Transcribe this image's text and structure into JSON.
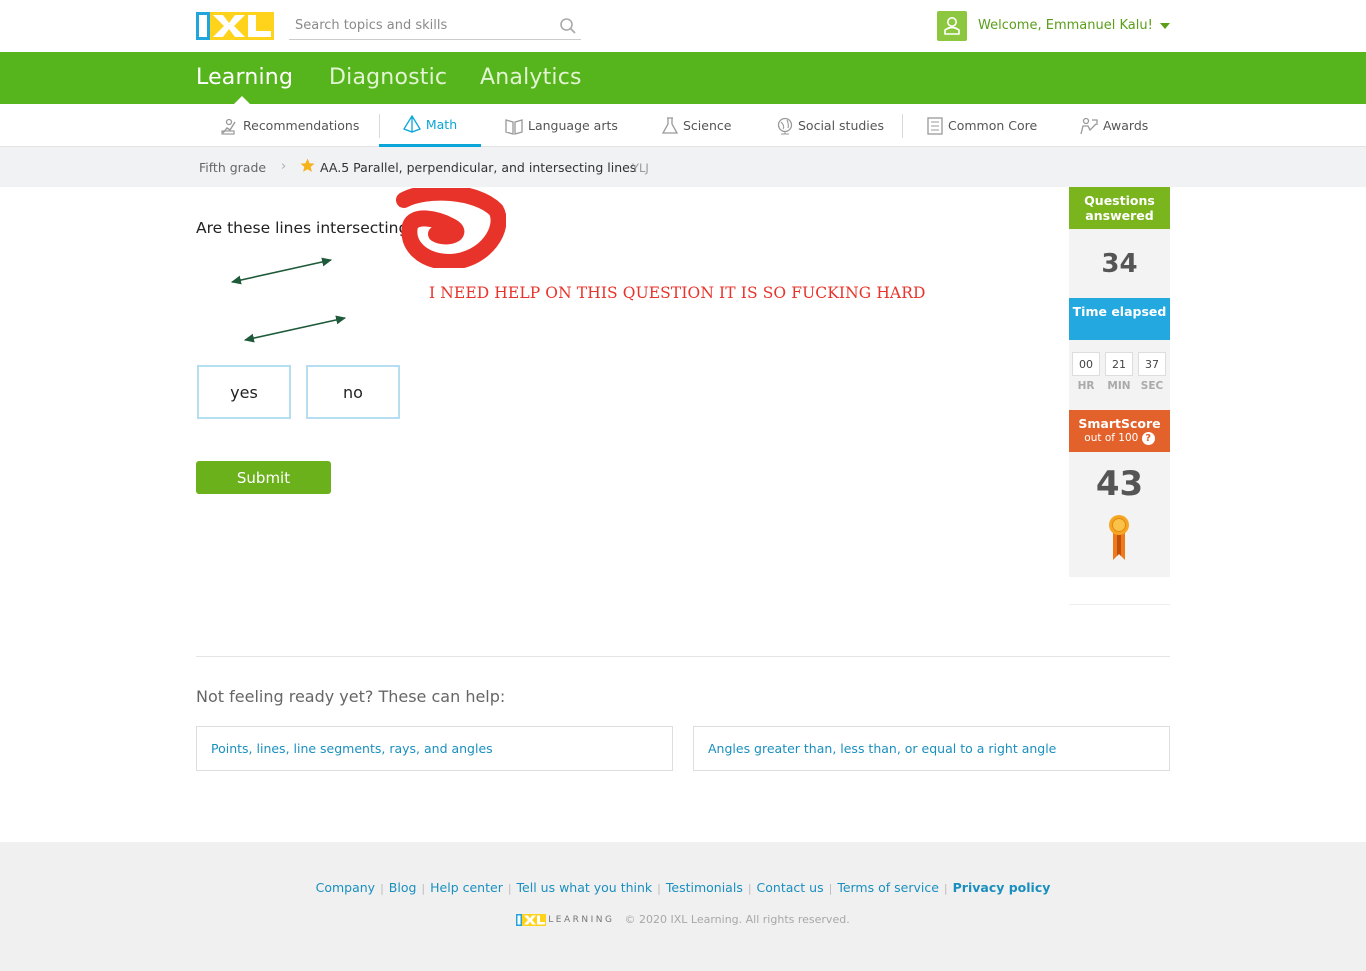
{
  "header": {
    "search_placeholder": "Search topics and skills",
    "welcome": "Welcome, Emmanuel Kalu!"
  },
  "main_nav": {
    "tabs": [
      {
        "label": "Learning",
        "active": true
      },
      {
        "label": "Diagnostic",
        "active": false
      },
      {
        "label": "Analytics",
        "active": false
      }
    ]
  },
  "subject_nav": {
    "items": [
      {
        "label": "Recommendations",
        "icon": "recommendations-icon"
      },
      {
        "label": "Math",
        "icon": "math-pyramid-icon",
        "active": true
      },
      {
        "label": "Language arts",
        "icon": "book-icon"
      },
      {
        "label": "Science",
        "icon": "flask-icon"
      },
      {
        "label": "Social studies",
        "icon": "globe-icon"
      },
      {
        "label": "Common Core",
        "icon": "list-icon"
      },
      {
        "label": "Awards",
        "icon": "awards-icon"
      }
    ]
  },
  "breadcrumb": {
    "grade": "Fifth grade",
    "skill": "AA.5 Parallel, perpendicular, and intersecting lines",
    "code": "YLJ"
  },
  "question": {
    "prompt": "Are these lines intersecting?",
    "annotation": "I NEED HELP ON THIS QUESTION IT IS SO FUCKING HARD",
    "choices": [
      "yes",
      "no"
    ],
    "submit_label": "Submit"
  },
  "stats": {
    "questions_answered_label": "Questions answered",
    "questions_answered": "34",
    "time_elapsed_label": "Time elapsed",
    "time": {
      "hr": "00",
      "min": "21",
      "sec": "37"
    },
    "time_units": {
      "hr": "HR",
      "min": "MIN",
      "sec": "SEC"
    },
    "smartscore_label": "SmartScore",
    "smartscore_sub": "out of 100",
    "smartscore_help": "?",
    "smartscore": "43"
  },
  "help_section": {
    "title": "Not feeling ready yet? These can help:",
    "cards": [
      "Points, lines, line segments, rays, and angles",
      "Angles greater than, less than, or equal to a right angle"
    ]
  },
  "footer": {
    "links": [
      "Company",
      "Blog",
      "Help center",
      "Tell us what you think",
      "Testimonials",
      "Contact us",
      "Terms of service"
    ],
    "privacy": "Privacy policy",
    "logo_word": "LEARNING",
    "copyright": "© 2020 IXL Learning. All rights reserved."
  },
  "colors": {
    "brand_green": "#56b51d",
    "accent_blue": "#0aa6d8",
    "annotation_red": "#e8332a",
    "smartscore_orange": "#e3612a"
  }
}
